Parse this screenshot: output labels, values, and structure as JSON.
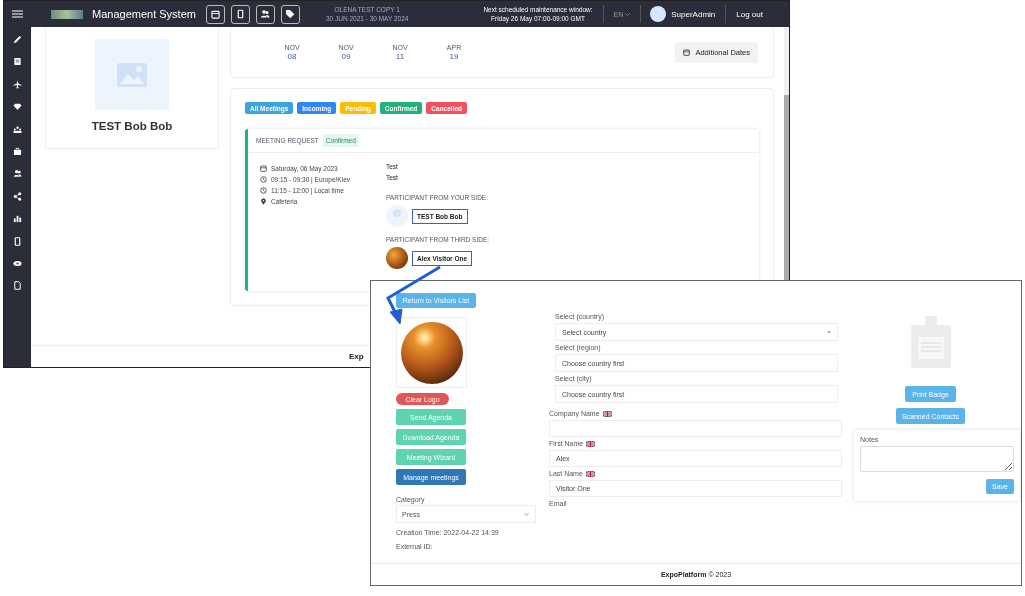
{
  "window_main": {
    "header": {
      "app_title": "Management System",
      "event_name": "OLENA TEST COPY 1",
      "event_dates": "30 JUN 2021 - 30 MAY 2024",
      "maintenance_title": "Next scheduled maintenance window:",
      "maintenance_time": "Friday 26 May 07:00-09:00 GMT",
      "language": "EN",
      "user_name": "SuperAdmin",
      "logout": "Log out"
    },
    "profile": {
      "name": "TEST Bob Bob"
    },
    "dates": [
      {
        "month": "NOV",
        "day": "08"
      },
      {
        "month": "NOV",
        "day": "09"
      },
      {
        "month": "NOV",
        "day": "11"
      },
      {
        "month": "APR",
        "day": "19"
      }
    ],
    "additional_dates_button": "Additional Dates",
    "filters": [
      {
        "label": "All Meetings",
        "color": "#3ba3e0"
      },
      {
        "label": "Incoming",
        "color": "#2f86f6"
      },
      {
        "label": "Pending",
        "color": "#fbbc05"
      },
      {
        "label": "Confirmed",
        "color": "#20b27a"
      },
      {
        "label": "Cancelled",
        "color": "#f1515f"
      }
    ],
    "meeting": {
      "title": "MEETING REQUEST",
      "status": "Confirmed",
      "date": "Saturday, 06 May 2023",
      "time": "09:15 - 09:30 | Europe/Kiev",
      "local_time": "11:15 - 12:00 | Local time",
      "location": "Cafeteria",
      "subject": "Test",
      "description": "Test",
      "your_side_label": "PARTICIPANT FROM YOUR SIDE:",
      "your_side_name": "TEST Bob Bob",
      "third_side_label": "PARTICIPANT FROM THIRD SIDE:",
      "third_side_name": "Alex Visitor One"
    },
    "footer": "Exp"
  },
  "window_visitor": {
    "return_button": "Return to Visitors List",
    "clear_logo_button": "Clear Logo",
    "action_buttons": [
      {
        "label": "Send Agenda",
        "kind": "secondary"
      },
      {
        "label": "Download Agenda",
        "kind": "secondary"
      },
      {
        "label": "Meeting Wizard",
        "kind": "secondary"
      },
      {
        "label": "Manage meetings",
        "kind": "primary"
      }
    ],
    "category": {
      "label": "Category",
      "value": "Press"
    },
    "creation_time": "Creation Time: 2022-04-22 14:39",
    "external_id": "External ID:",
    "fields": [
      {
        "kind": "select",
        "label": "Select (country)",
        "value": "Select country",
        "flag": false
      },
      {
        "kind": "location",
        "label": "Select (region)",
        "value": "Choose country first",
        "flag": false
      },
      {
        "kind": "location",
        "label": "Select (city)",
        "value": "Choose country first",
        "flag": false
      },
      {
        "kind": "input",
        "label": "Company Name",
        "flag": true
      },
      {
        "kind": "input",
        "label": "First Name",
        "value": "Alex",
        "flag": true
      },
      {
        "kind": "input",
        "label": "Last Name",
        "value": "Visitor One",
        "flag": true
      },
      {
        "kind": "label",
        "label": "Email",
        "flag": false
      }
    ],
    "print_badge_button": "Print Badge",
    "scanned_contacts_button": "Scanned Contacts",
    "notes": {
      "label": "Notes",
      "save_button": "Save"
    },
    "footer": "**ExpoPlatform** © 2023"
  }
}
